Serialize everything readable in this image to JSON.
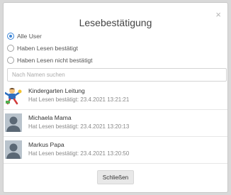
{
  "dialog": {
    "title": "Lesebestätigung",
    "close_glyph": "×"
  },
  "filters": [
    {
      "label": "Alle User",
      "checked": true
    },
    {
      "label": "Haben Lesen bestätigt",
      "checked": false
    },
    {
      "label": "Haben Lesen nicht bestätigt",
      "checked": false
    }
  ],
  "search": {
    "placeholder": "Nach Namen suchen",
    "value": ""
  },
  "users": [
    {
      "name": "Kindergarten Leitung",
      "status": "Hat Lesen bestätigt: 23.4.2021 13:21:21",
      "avatar": "kindergarten-logo-icon"
    },
    {
      "name": "Michaela Mama",
      "status": "Hat Lesen bestätigt: 23.4.2021 13:20:13",
      "avatar": "default-user-avatar-icon"
    },
    {
      "name": "Markus Papa",
      "status": "Hat Lesen bestätigt: 23.4.2021 13:20:50",
      "avatar": "default-user-avatar-icon"
    }
  ],
  "footer": {
    "close_label": "Schließen"
  },
  "colors": {
    "accent": "#3a84d6",
    "button_bg": "#e8e8e8",
    "overlay": "#d9d9d9",
    "avatar_bg": "#b9c3cc",
    "avatar_fg": "#5b6875"
  }
}
